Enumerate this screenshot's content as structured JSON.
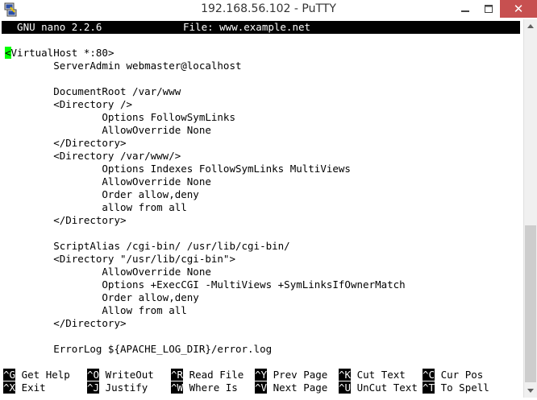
{
  "window": {
    "title": "192.168.56.102 - PuTTY",
    "close_glyph": "✕",
    "min_glyph": "—",
    "max_glyph": "☐"
  },
  "nano": {
    "version": "  GNU nano 2.2.6",
    "file_label": "File: www.example.net"
  },
  "editor": {
    "first_char": "<",
    "first_rest": "VirtualHost *:80>",
    "lines": [
      "        ServerAdmin webmaster@localhost",
      "",
      "        DocumentRoot /var/www",
      "        <Directory />",
      "                Options FollowSymLinks",
      "                AllowOverride None",
      "        </Directory>",
      "        <Directory /var/www/>",
      "                Options Indexes FollowSymLinks MultiViews",
      "                AllowOverride None",
      "                Order allow,deny",
      "                allow from all",
      "        </Directory>",
      "",
      "        ScriptAlias /cgi-bin/ /usr/lib/cgi-bin/",
      "        <Directory \"/usr/lib/cgi-bin\">",
      "                AllowOverride None",
      "                Options +ExecCGI -MultiViews +SymLinksIfOwnerMatch",
      "                Order allow,deny",
      "                Allow from all",
      "        </Directory>",
      "",
      "        ErrorLog ${APACHE_LOG_DIR}/error.log"
    ]
  },
  "shortcuts": {
    "row1": [
      {
        "key": "^G",
        "label": " Get Help"
      },
      {
        "key": "^O",
        "label": " WriteOut"
      },
      {
        "key": "^R",
        "label": " Read File"
      },
      {
        "key": "^Y",
        "label": " Prev Page"
      },
      {
        "key": "^K",
        "label": " Cut Text"
      },
      {
        "key": "^C",
        "label": " Cur Pos"
      }
    ],
    "row2": [
      {
        "key": "^X",
        "label": " Exit"
      },
      {
        "key": "^J",
        "label": " Justify"
      },
      {
        "key": "^W",
        "label": " Where Is"
      },
      {
        "key": "^V",
        "label": " Next Page"
      },
      {
        "key": "^U",
        "label": " UnCut Text"
      },
      {
        "key": "^T",
        "label": " To Spell"
      }
    ]
  }
}
